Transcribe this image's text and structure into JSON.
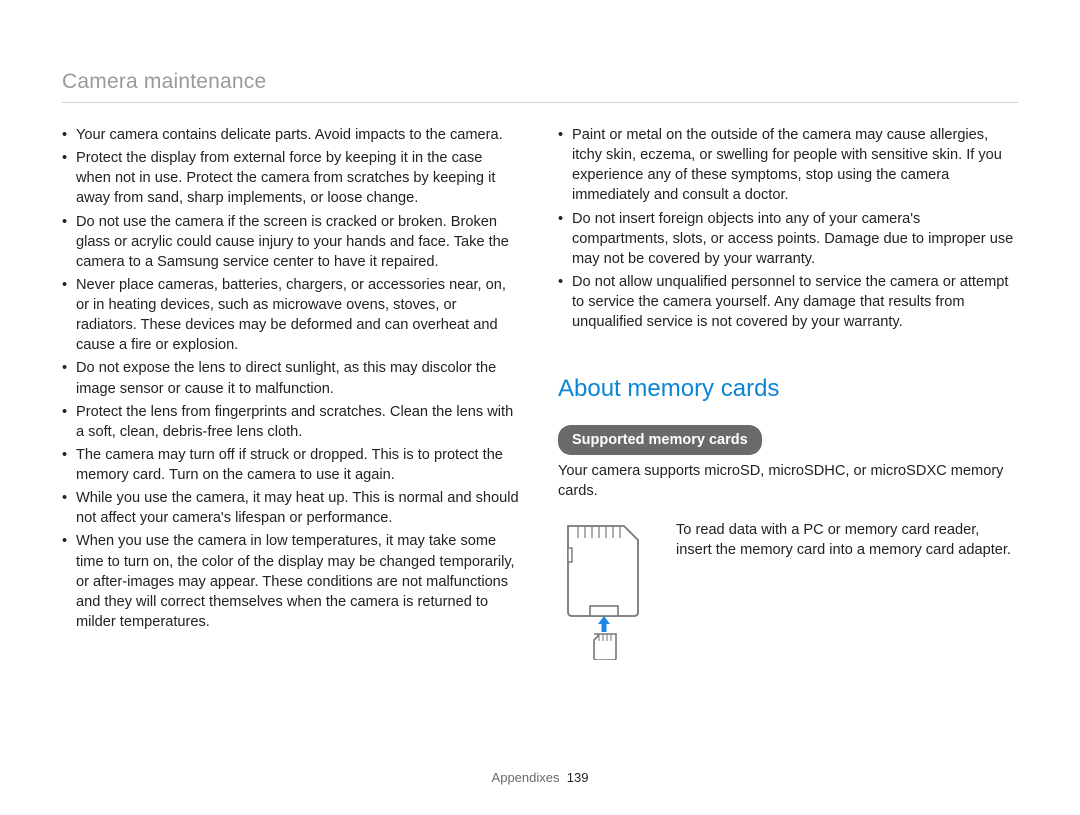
{
  "header": {
    "title": "Camera maintenance"
  },
  "left_bullets": [
    "Your camera contains delicate parts. Avoid impacts to the camera.",
    "Protect the display from external force by keeping it in the case when not in use. Protect the camera from scratches by keeping it away from sand, sharp implements, or loose change.",
    "Do not use the camera if the screen is cracked or broken. Broken glass or acrylic could cause injury to your hands and face. Take the camera to a Samsung service center to have it repaired.",
    "Never place cameras, batteries, chargers, or accessories near, on, or in heating devices, such as microwave ovens, stoves, or radiators. These devices may be deformed and can overheat and cause a fire or explosion.",
    "Do not expose the lens to direct sunlight, as this may discolor the image sensor or cause it to malfunction.",
    "Protect the lens from fingerprints and scratches. Clean the lens with a soft, clean, debris-free lens cloth.",
    "The camera may turn off if struck or dropped. This is to protect the memory card. Turn on the camera to use it again.",
    "While you use the camera, it may heat up. This is normal and should not affect your camera's lifespan or performance.",
    "When you use the camera in low temperatures, it may take some time to turn on, the color of the display may be changed temporarily, or after-images may appear. These conditions are not malfunctions and they will correct themselves when the camera is returned to milder temperatures."
  ],
  "right_bullets": [
    "Paint or metal on the outside of the camera may cause allergies, itchy skin, eczema, or swelling for people with sensitive skin. If you experience any of these symptoms, stop using the camera immediately and consult a doctor.",
    "Do not insert foreign objects into any of your camera's compartments, slots, or access points. Damage due to improper use may not be covered by your warranty.",
    "Do not allow unqualified personnel to service the camera or attempt to service the camera yourself. Any damage that results from unqualified service is not covered by your warranty."
  ],
  "memory": {
    "heading": "About memory cards",
    "pill": "Supported memory cards",
    "support_text": "Your camera supports microSD, microSDHC, or microSDXC memory cards.",
    "note": "To read data with a PC or memory card reader, insert the memory card into a memory card adapter."
  },
  "footer": {
    "section": "Appendixes",
    "page": "139"
  }
}
